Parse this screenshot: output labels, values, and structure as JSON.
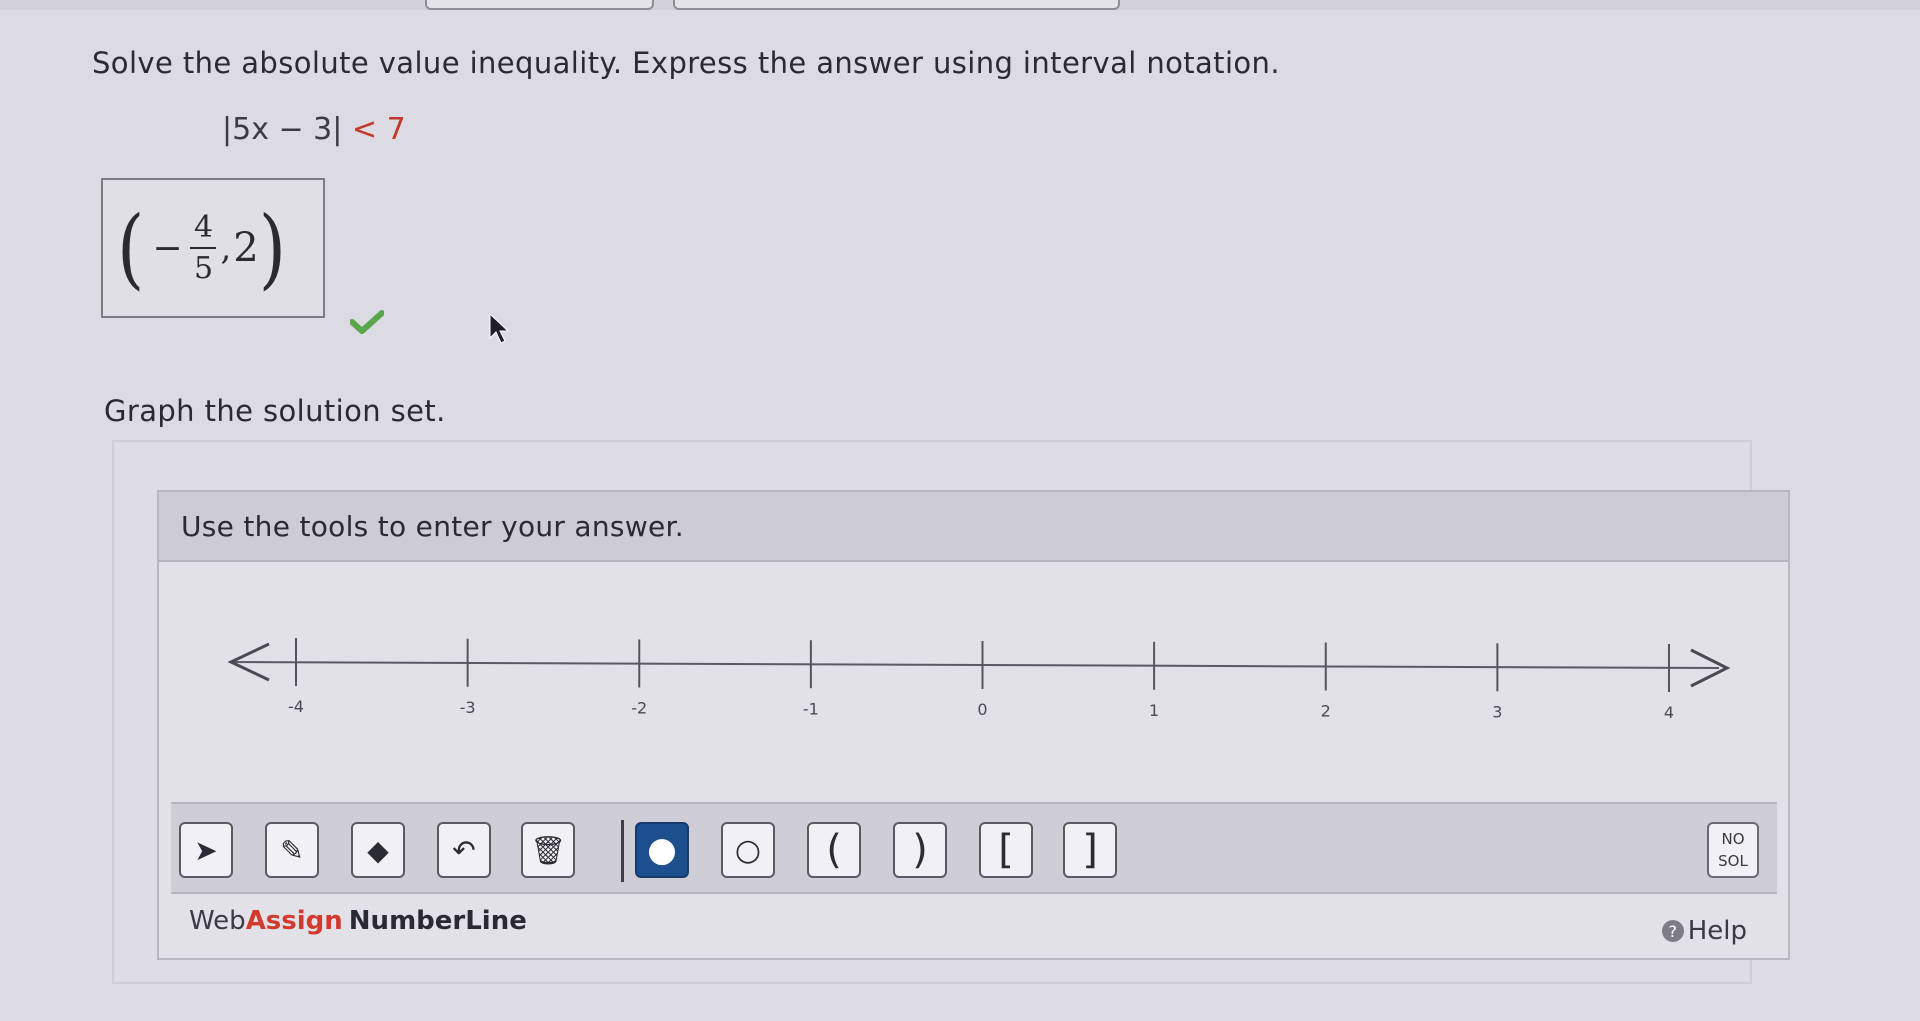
{
  "question": {
    "prompt": "Solve the absolute value inequality. Express the answer using interval notation.",
    "inequality_lhs": "|5x − 3|",
    "inequality_op": "<",
    "inequality_rhs": "7"
  },
  "answer": {
    "open_paren": "(",
    "minus": "−",
    "numerator": "4",
    "denominator": "5",
    "comma": ",",
    "upper": "2",
    "close_paren": ")",
    "status": "correct"
  },
  "graph": {
    "label": "Graph the solution set.",
    "instructions": "Use the tools to enter your answer."
  },
  "numberline": {
    "min": -4,
    "max": 4,
    "ticks": [
      "-4",
      "-3",
      "-2",
      "-1",
      "0",
      "1",
      "2",
      "3",
      "4"
    ]
  },
  "toolbar": {
    "tools": [
      {
        "name": "pointer-tool",
        "glyph": "➤"
      },
      {
        "name": "pencil-tool",
        "glyph": "✎"
      },
      {
        "name": "eraser-tool",
        "glyph": "◆"
      },
      {
        "name": "undo-tool",
        "glyph": "↶"
      },
      {
        "name": "trash-tool",
        "glyph": "🗑"
      },
      {
        "name": "closed-dot-tool",
        "glyph": "●"
      },
      {
        "name": "open-dot-tool",
        "glyph": "○"
      },
      {
        "name": "left-paren-tool",
        "glyph": "("
      },
      {
        "name": "right-paren-tool",
        "glyph": ")"
      },
      {
        "name": "left-bracket-tool",
        "glyph": "["
      },
      {
        "name": "right-bracket-tool",
        "glyph": "]"
      }
    ],
    "no_solution_line1": "NO",
    "no_solution_line2": "SOL"
  },
  "footer": {
    "brand_web": "Web",
    "brand_assign": "Assign",
    "brand_product": "NumberLine",
    "help_label": "Help"
  }
}
